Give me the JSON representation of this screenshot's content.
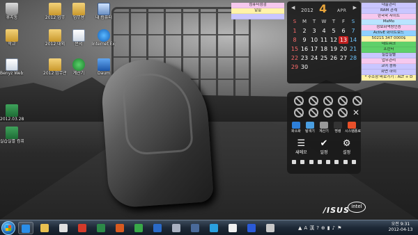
{
  "desktop_icons": [
    {
      "label": "휴지통",
      "icon": "trash-icon"
    },
    {
      "label": "2012 업무",
      "icon": "folder-icon"
    },
    {
      "label": "업무용",
      "icon": "folder-icon"
    },
    {
      "label": "내 컴퓨터",
      "icon": "computer-icon"
    },
    {
      "label": "학교",
      "icon": "folder-icon"
    },
    {
      "label": "2012 대외",
      "icon": "folder-icon"
    },
    {
      "label": "문서",
      "icon": "document-icon"
    },
    {
      "label": "Internet Explorer",
      "icon": "internet-explorer-icon"
    },
    {
      "label": "Benyz WebShare",
      "icon": "webshare-icon"
    },
    {
      "label": "2012 업무관리",
      "icon": "folder-icon"
    },
    {
      "label": "계산기",
      "icon": "green-app-icon"
    },
    {
      "label": "Daum",
      "icon": "blue-app-icon"
    },
    {
      "label": "2012.03.28",
      "icon": "excel-icon"
    },
    {
      "label": "실습실별 컴퓨터",
      "icon": "excel-icon"
    }
  ],
  "notes_mid": [
    {
      "text": "컴퓨터점검",
      "color": "#f6c8ee"
    },
    {
      "text": "일일",
      "color": "#fff3a8"
    },
    {
      "text": "",
      "color": "#c9c6ff"
    }
  ],
  "notes_right": [
    {
      "text": "대출관리",
      "color": "#c9c6ff"
    },
    {
      "text": "RAM 관계",
      "color": "#c9c6ff"
    },
    {
      "text": "한국학 사이트",
      "color": "#f6c8ee"
    },
    {
      "text": "MeMo",
      "color": "#b9e4ff"
    },
    {
      "text": "정보화역량인증",
      "color": "#f6c8ee"
    },
    {
      "text": "ActivE 화이트보드",
      "color": "#8fd0ff"
    },
    {
      "text": "5021S 347 0000$",
      "color": "#fff3a8"
    },
    {
      "text": "네트워크",
      "color": "#5fd06a"
    },
    {
      "text": "프린터",
      "color": "#5fd06a"
    },
    {
      "text": "실습실별",
      "color": "#c9c6ff"
    },
    {
      "text": "업무관리",
      "color": "#f6c8ee"
    },
    {
      "text": "코어 종류",
      "color": "#c9c6ff"
    },
    {
      "text": "화면 하이",
      "color": "#c9c6ff"
    },
    {
      "text": "* 주소창 바로가기 : ALT + D",
      "color": "#fff3a8"
    }
  ],
  "calendar": {
    "year": "2012",
    "month_num": "4",
    "month_name": "APR",
    "prev": "◀",
    "next": "▶",
    "day_headers": [
      "S",
      "M",
      "T",
      "W",
      "T",
      "F",
      "S"
    ],
    "weeks": [
      [
        "1",
        "2",
        "3",
        "4",
        "5",
        "6",
        "7"
      ],
      [
        "8",
        "9",
        "10",
        "11",
        "12",
        "13",
        "14"
      ],
      [
        "15",
        "16",
        "17",
        "18",
        "19",
        "20",
        "21"
      ],
      [
        "22",
        "23",
        "24",
        "25",
        "26",
        "27",
        "28"
      ],
      [
        "29",
        "30",
        "",
        "",
        "",
        "",
        ""
      ]
    ],
    "today": "13"
  },
  "launcher": {
    "empty_slots": 9,
    "tools_icon": "✕",
    "apps": [
      {
        "label": "화소화",
        "color": "#2e7fd8"
      },
      {
        "label": "탐색기",
        "color": "#4a9ee0"
      },
      {
        "label": "계산기",
        "color": "#999999"
      },
      {
        "label": "명령",
        "color": "#333333"
      },
      {
        "label": "시스템종료",
        "color": "#e8502a"
      }
    ],
    "main_buttons": [
      {
        "label": "새메모",
        "icon": "note-icon",
        "glyph": "☰"
      },
      {
        "label": "일정",
        "icon": "check-icon",
        "glyph": "✔"
      },
      {
        "label": "설정",
        "icon": "gear-icon",
        "glyph": "⚙"
      }
    ],
    "strip_count": 8
  },
  "branding": {
    "asus": "/ISUS",
    "intel": "intel"
  },
  "taskbar": {
    "pinned": [
      {
        "name": "internet-explorer",
        "color": "#2a8ee8",
        "active": true
      },
      {
        "name": "explorer",
        "color": "#e8c050",
        "active": false
      },
      {
        "name": "media",
        "color": "#e0e0e0",
        "active": false
      },
      {
        "name": "app-red",
        "color": "#d43a2a",
        "active": false
      },
      {
        "name": "excel",
        "color": "#2c8a48",
        "active": false
      },
      {
        "name": "powerpoint",
        "color": "#d85a20",
        "active": false
      },
      {
        "name": "utorrent",
        "color": "#38a848",
        "active": false
      },
      {
        "name": "hangul",
        "color": "#2a6ac8",
        "active": false
      },
      {
        "name": "app-gray",
        "color": "#a8b0c0",
        "active": false
      },
      {
        "name": "window",
        "color": "#4a6a9a",
        "active": false
      },
      {
        "name": "skype",
        "color": "#2aa0e0",
        "active": false
      },
      {
        "name": "document",
        "color": "#f0f0f0",
        "active": false
      },
      {
        "name": "daum",
        "color": "#2a5ad8",
        "active": false
      },
      {
        "name": "paint",
        "color": "#c8c8c8",
        "active": false
      }
    ],
    "tray": [
      "▲",
      "A",
      "漢",
      "?",
      "⊕",
      "▮",
      "♪",
      "⚑"
    ],
    "time": "오전 9:31",
    "date": "2012-04-13"
  }
}
